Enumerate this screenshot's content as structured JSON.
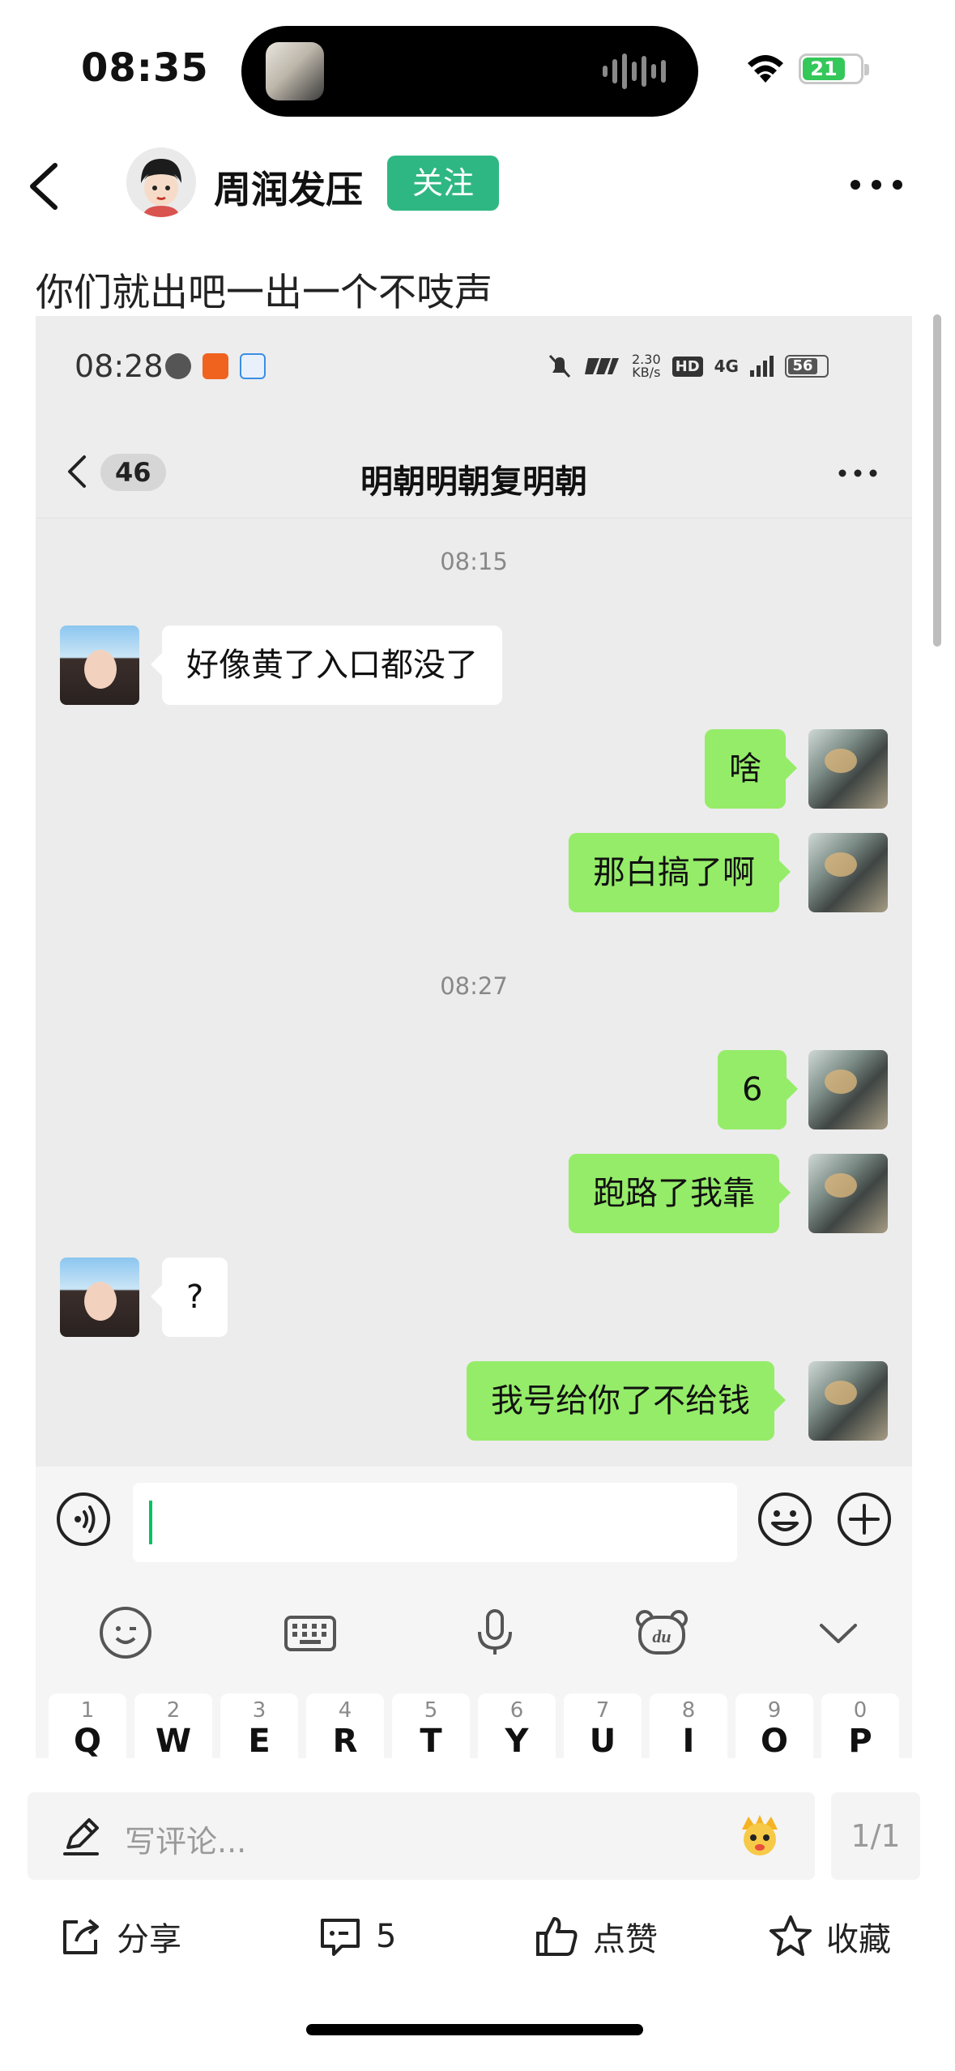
{
  "status_bar": {
    "time": "08:35",
    "battery": "21"
  },
  "post": {
    "author": "周润发压",
    "follow_label": "关注",
    "text": "你们就出吧一出一个不吱声"
  },
  "screenshot": {
    "status": {
      "time": "08:28",
      "speed_top": "2.30",
      "speed_bottom": "KB/s",
      "hd": "HD",
      "network": "4G",
      "battery": "56"
    },
    "chat": {
      "unread_count": "46",
      "title": "明朝明朝复明朝",
      "messages": [
        {
          "type": "time",
          "text": "08:15"
        },
        {
          "type": "in",
          "text": "好像黄了入口都没了"
        },
        {
          "type": "out",
          "text": "啥"
        },
        {
          "type": "out",
          "text": "那白搞了啊"
        },
        {
          "type": "time",
          "text": "08:27"
        },
        {
          "type": "out",
          "text": "6"
        },
        {
          "type": "out",
          "text": "跑路了我靠"
        },
        {
          "type": "in",
          "text": "?"
        },
        {
          "type": "out",
          "text": "我号给你了不给钱"
        }
      ]
    },
    "keyboard": {
      "keys": [
        {
          "num": "1",
          "letter": "Q"
        },
        {
          "num": "2",
          "letter": "W"
        },
        {
          "num": "3",
          "letter": "E"
        },
        {
          "num": "4",
          "letter": "R"
        },
        {
          "num": "5",
          "letter": "T"
        },
        {
          "num": "6",
          "letter": "Y"
        },
        {
          "num": "7",
          "letter": "U"
        },
        {
          "num": "8",
          "letter": "I"
        },
        {
          "num": "9",
          "letter": "O"
        },
        {
          "num": "0",
          "letter": "P"
        }
      ]
    }
  },
  "comment": {
    "placeholder": "写评论...",
    "page_indicator": "1/1"
  },
  "actions": {
    "share": "分享",
    "comments": "5",
    "like": "点赞",
    "favorite": "收藏"
  },
  "colors": {
    "follow": "#2fb783",
    "outgoing_bubble": "#95ec69",
    "incoming_bubble": "#ffffff",
    "chat_bg": "#ececec"
  }
}
